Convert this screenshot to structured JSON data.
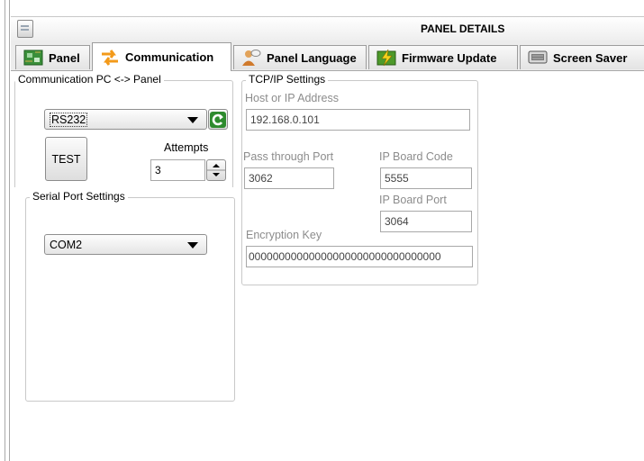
{
  "window": {
    "title": "PANEL DETAILS"
  },
  "tabs": [
    {
      "label": "Panel",
      "icon": "circuit-board-icon",
      "active": false
    },
    {
      "label": "Communication",
      "icon": "exchange-arrows-icon",
      "active": true
    },
    {
      "label": "Panel Language",
      "icon": "person-speech-icon",
      "active": false
    },
    {
      "label": "Firmware Update",
      "icon": "lightning-chip-icon",
      "active": false
    },
    {
      "label": "Screen Saver",
      "icon": "monitor-icon",
      "active": false
    }
  ],
  "communication": {
    "legend": "Communication PC <-> Panel",
    "protocol_selected": "RS232",
    "refresh_icon": "refresh-icon",
    "test_label": "TEST",
    "attempts_label": "Attempts",
    "attempts_value": "3"
  },
  "serial": {
    "legend": "Serial Port Settings",
    "port_selected": "COM2"
  },
  "tcpip": {
    "legend": "TCP/IP Settings",
    "host_label": "Host or IP Address",
    "host_value": "192.168.0.101",
    "pass_port_label": "Pass through Port",
    "pass_port_value": "3062",
    "board_code_label": "IP Board Code",
    "board_code_value": "5555",
    "board_port_label": "IP Board Port",
    "board_port_value": "3064",
    "enc_key_label": "Encryption Key",
    "enc_key_value": "00000000000000000000000000000000"
  },
  "colors": {
    "refresh_green": "#2e8b2e",
    "disabled_text": "#8c8c8c"
  }
}
